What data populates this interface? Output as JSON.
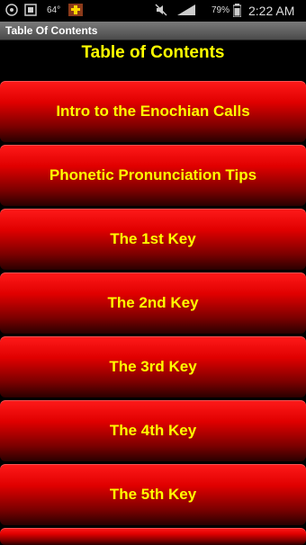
{
  "status_bar": {
    "temperature": "64°",
    "battery": "79%",
    "time": "2:22 AM",
    "icons": [
      "notification-icon",
      "screenshot-icon",
      "temperature-icon",
      "app-icon",
      "mute-icon",
      "signal-icon",
      "battery-icon"
    ]
  },
  "title_bar": {
    "title": "Table Of Contents"
  },
  "page_title": "Table of Contents",
  "items": [
    {
      "label": "Intro to the Enochian Calls"
    },
    {
      "label": "Phonetic Pronunciation Tips"
    },
    {
      "label": "The 1st Key"
    },
    {
      "label": "The 2nd Key"
    },
    {
      "label": "The 3rd Key"
    },
    {
      "label": "The 4th Key"
    },
    {
      "label": "The 5th Key"
    }
  ],
  "colors": {
    "accent_text": "#ffff00",
    "button_red": "#ff1a1a",
    "background": "#000000"
  }
}
